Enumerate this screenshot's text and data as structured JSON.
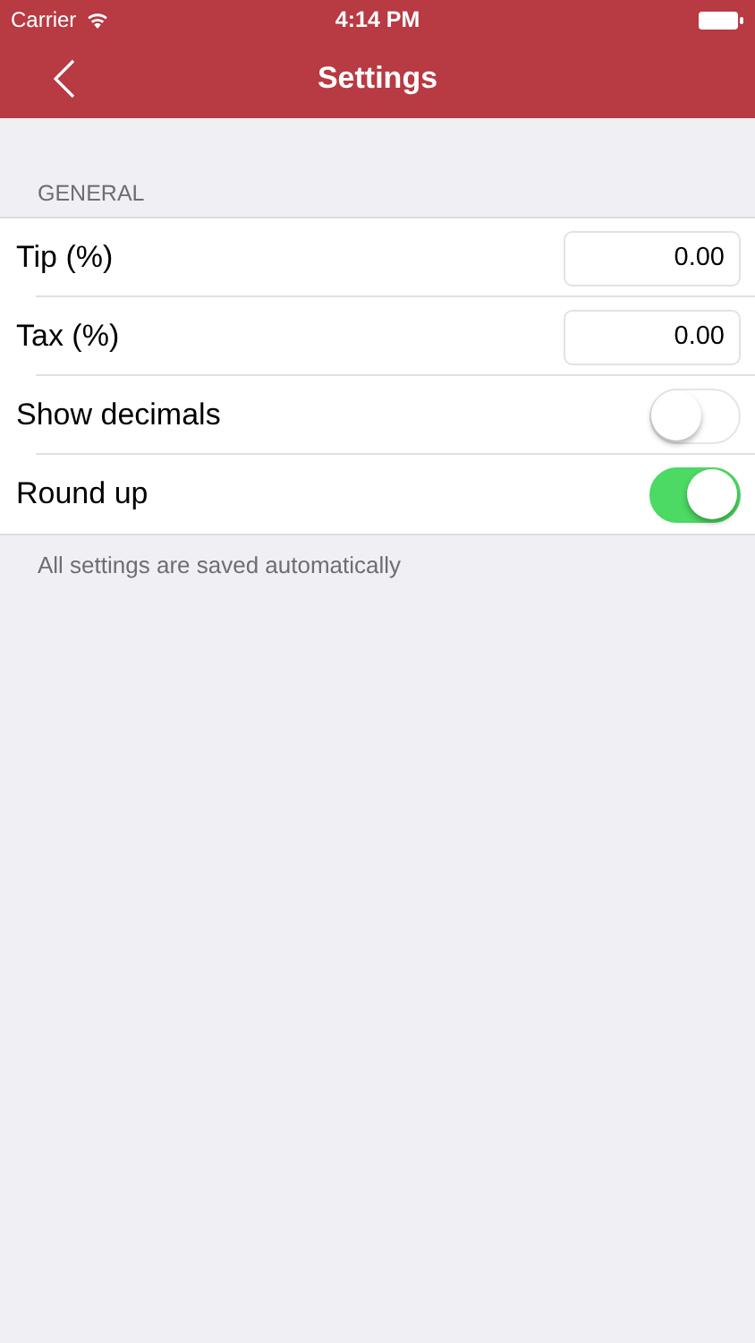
{
  "status_bar": {
    "carrier": "Carrier",
    "time": "4:14 PM"
  },
  "nav": {
    "title": "Settings"
  },
  "section": {
    "header": "GENERAL",
    "footer": "All settings are saved automatically",
    "rows": [
      {
        "kind": "input",
        "label": "Tip (%)",
        "value": "0.00"
      },
      {
        "kind": "input",
        "label": "Tax (%)",
        "value": "0.00"
      },
      {
        "kind": "toggle",
        "label": "Show decimals",
        "on": false
      },
      {
        "kind": "toggle",
        "label": "Round up",
        "on": true
      }
    ]
  }
}
